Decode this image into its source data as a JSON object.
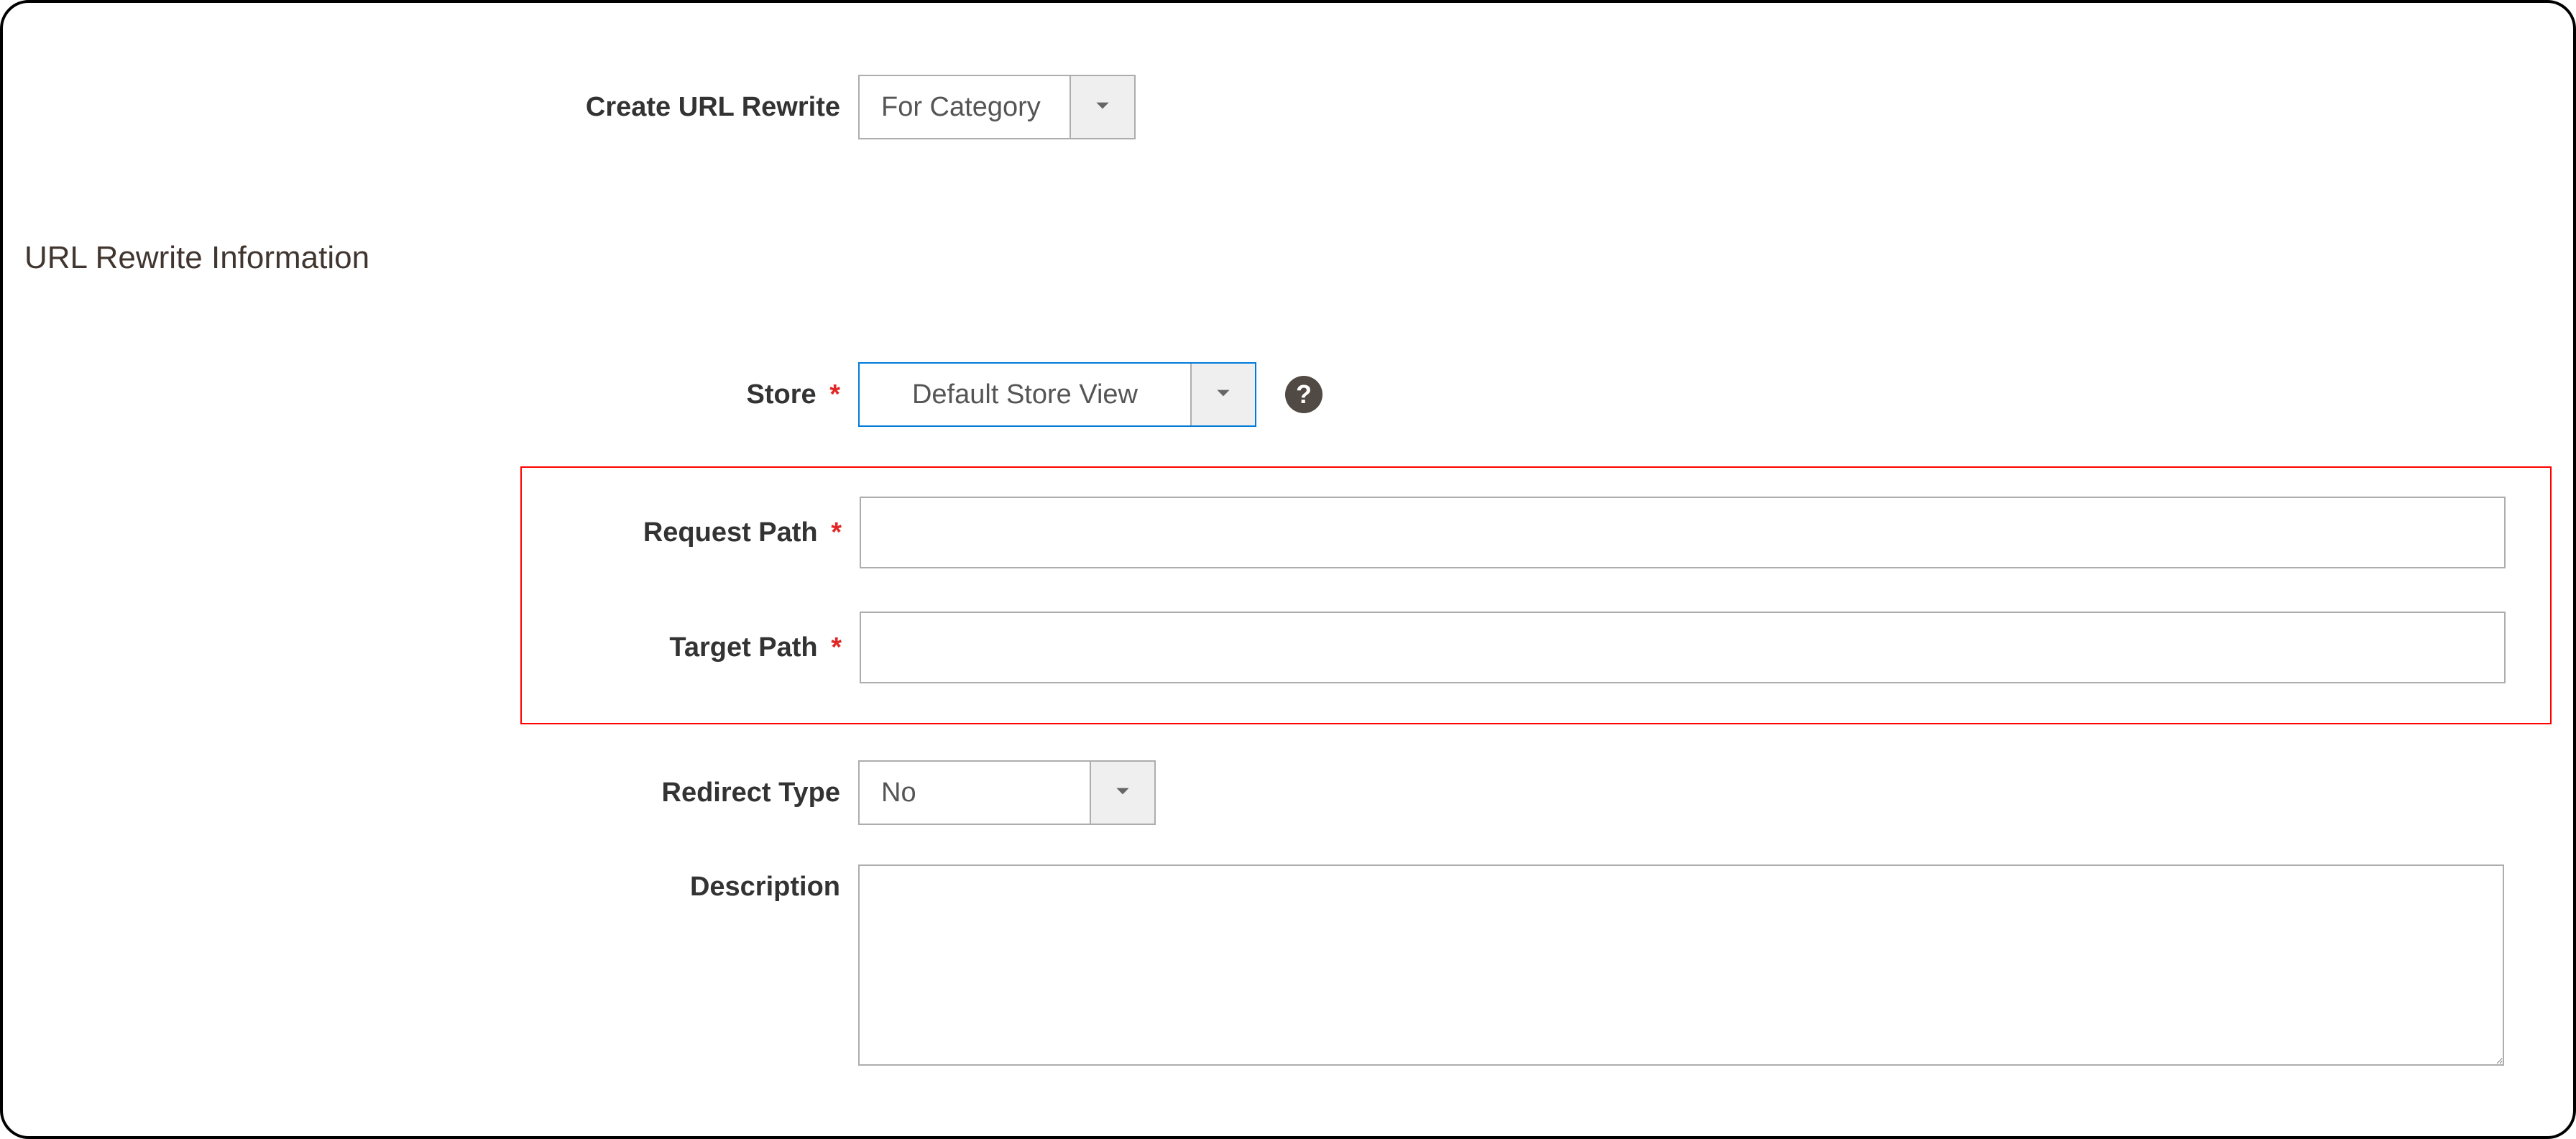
{
  "top": {
    "create_label": "Create URL Rewrite",
    "create_value": "For Category"
  },
  "section_title": "URL Rewrite Information",
  "fields": {
    "store": {
      "label": "Store",
      "value": "Default Store View"
    },
    "request_path": {
      "label": "Request Path",
      "value": ""
    },
    "target_path": {
      "label": "Target Path",
      "value": ""
    },
    "redirect_type": {
      "label": "Redirect Type",
      "value": "No"
    },
    "description": {
      "label": "Description",
      "value": ""
    }
  },
  "required_marker": "*"
}
